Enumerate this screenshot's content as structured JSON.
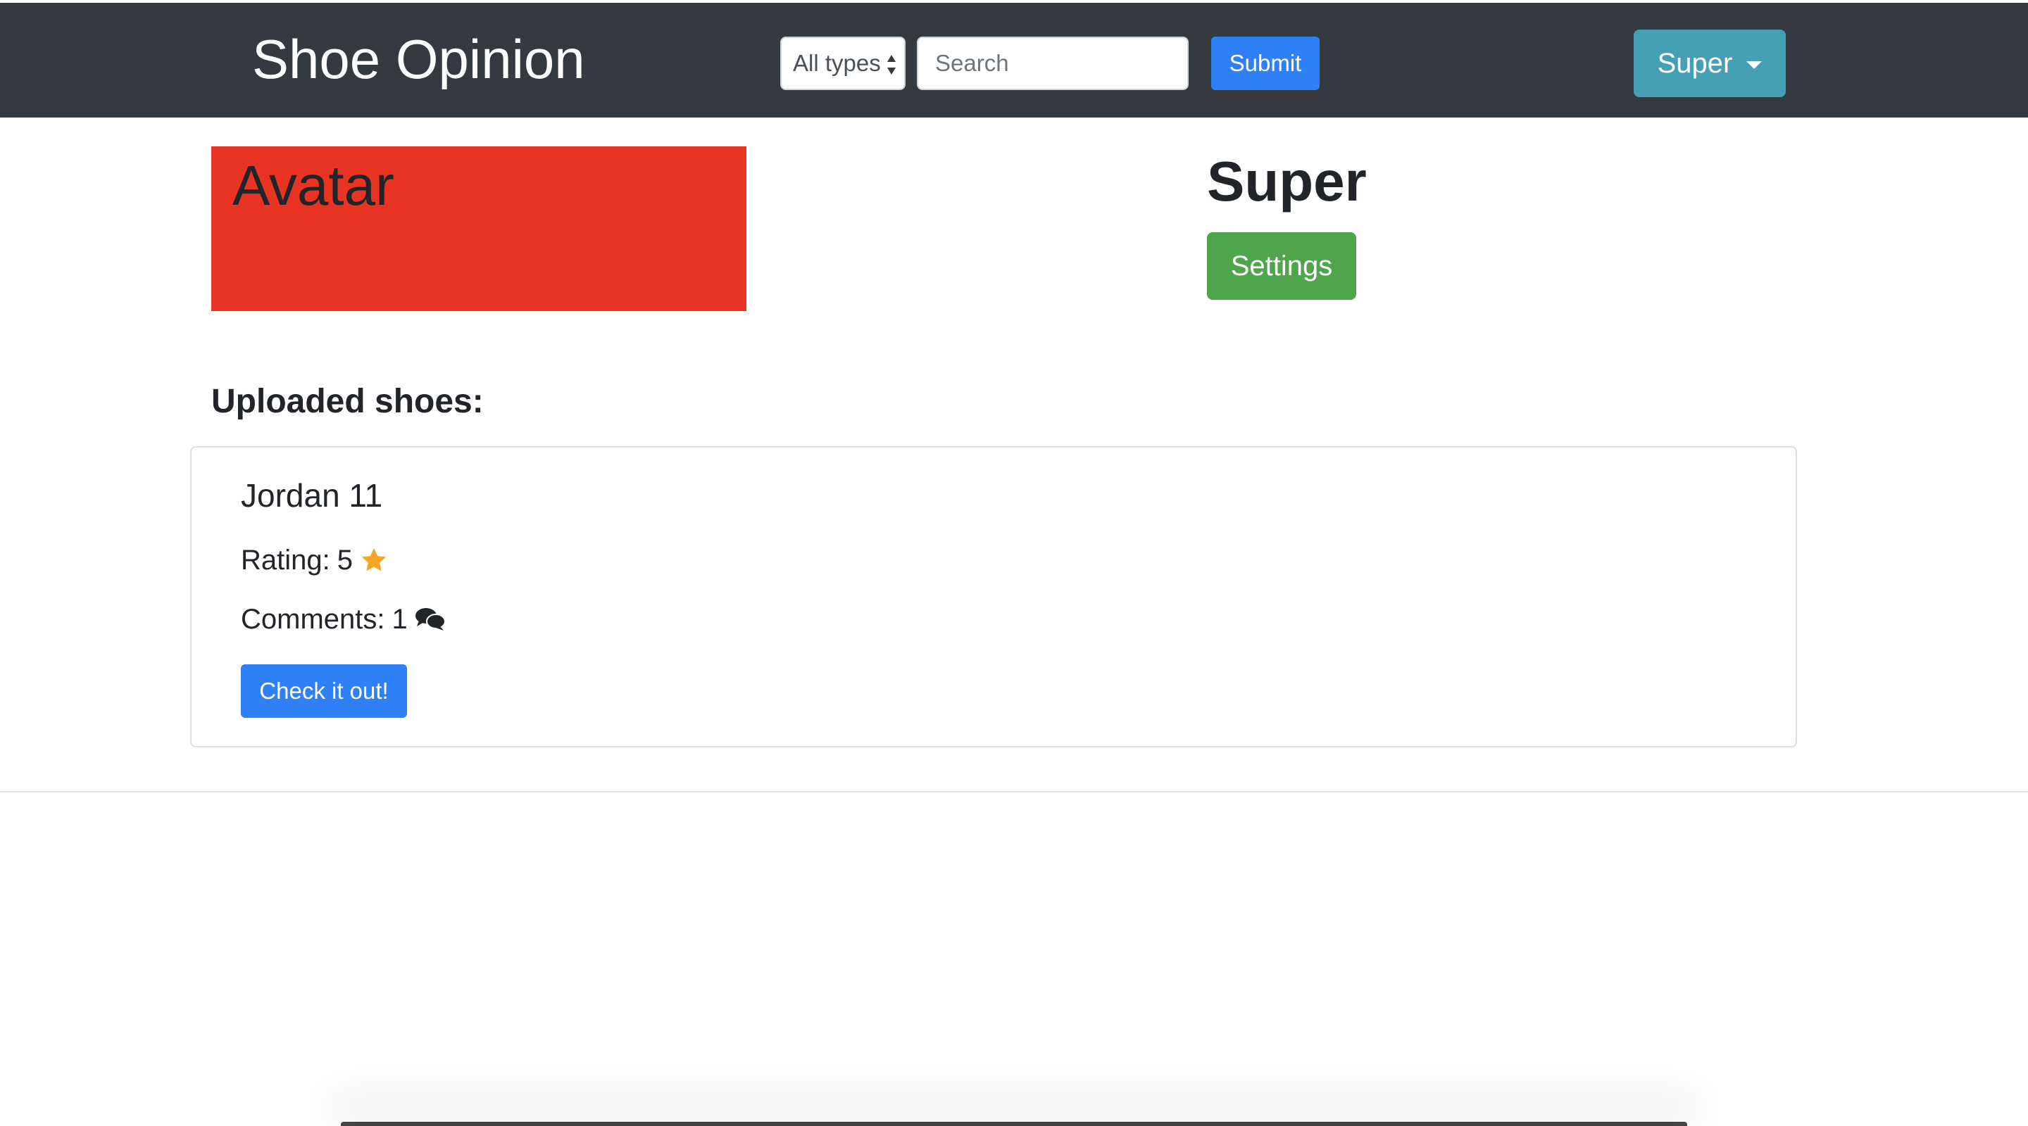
{
  "navbar": {
    "brand": "Shoe Opinion",
    "type_filter": {
      "selected": "All types"
    },
    "search": {
      "placeholder": "Search",
      "value": ""
    },
    "submit_label": "Submit",
    "user_menu_label": "Super"
  },
  "profile": {
    "avatar_label": "Avatar",
    "username": "Super",
    "settings_label": "Settings"
  },
  "uploads": {
    "title": "Uploaded shoes:",
    "items": [
      {
        "name": "Jordan 11",
        "rating_label": "Rating:",
        "rating_value": "5",
        "comments_label": "Comments:",
        "comments_value": "1",
        "button_label": "Check it out!"
      }
    ]
  },
  "icons": {
    "rating": "star-icon",
    "comments": "comments-icon",
    "dropdown": "caret-down-icon",
    "select": "select-arrows-icon"
  },
  "colors": {
    "navbar_bg": "#343a40",
    "primary": "#2f7ff7",
    "info": "#45a0b5",
    "success": "#4fa54b",
    "avatar_bg": "#ea3423",
    "star": "#f5a623"
  }
}
